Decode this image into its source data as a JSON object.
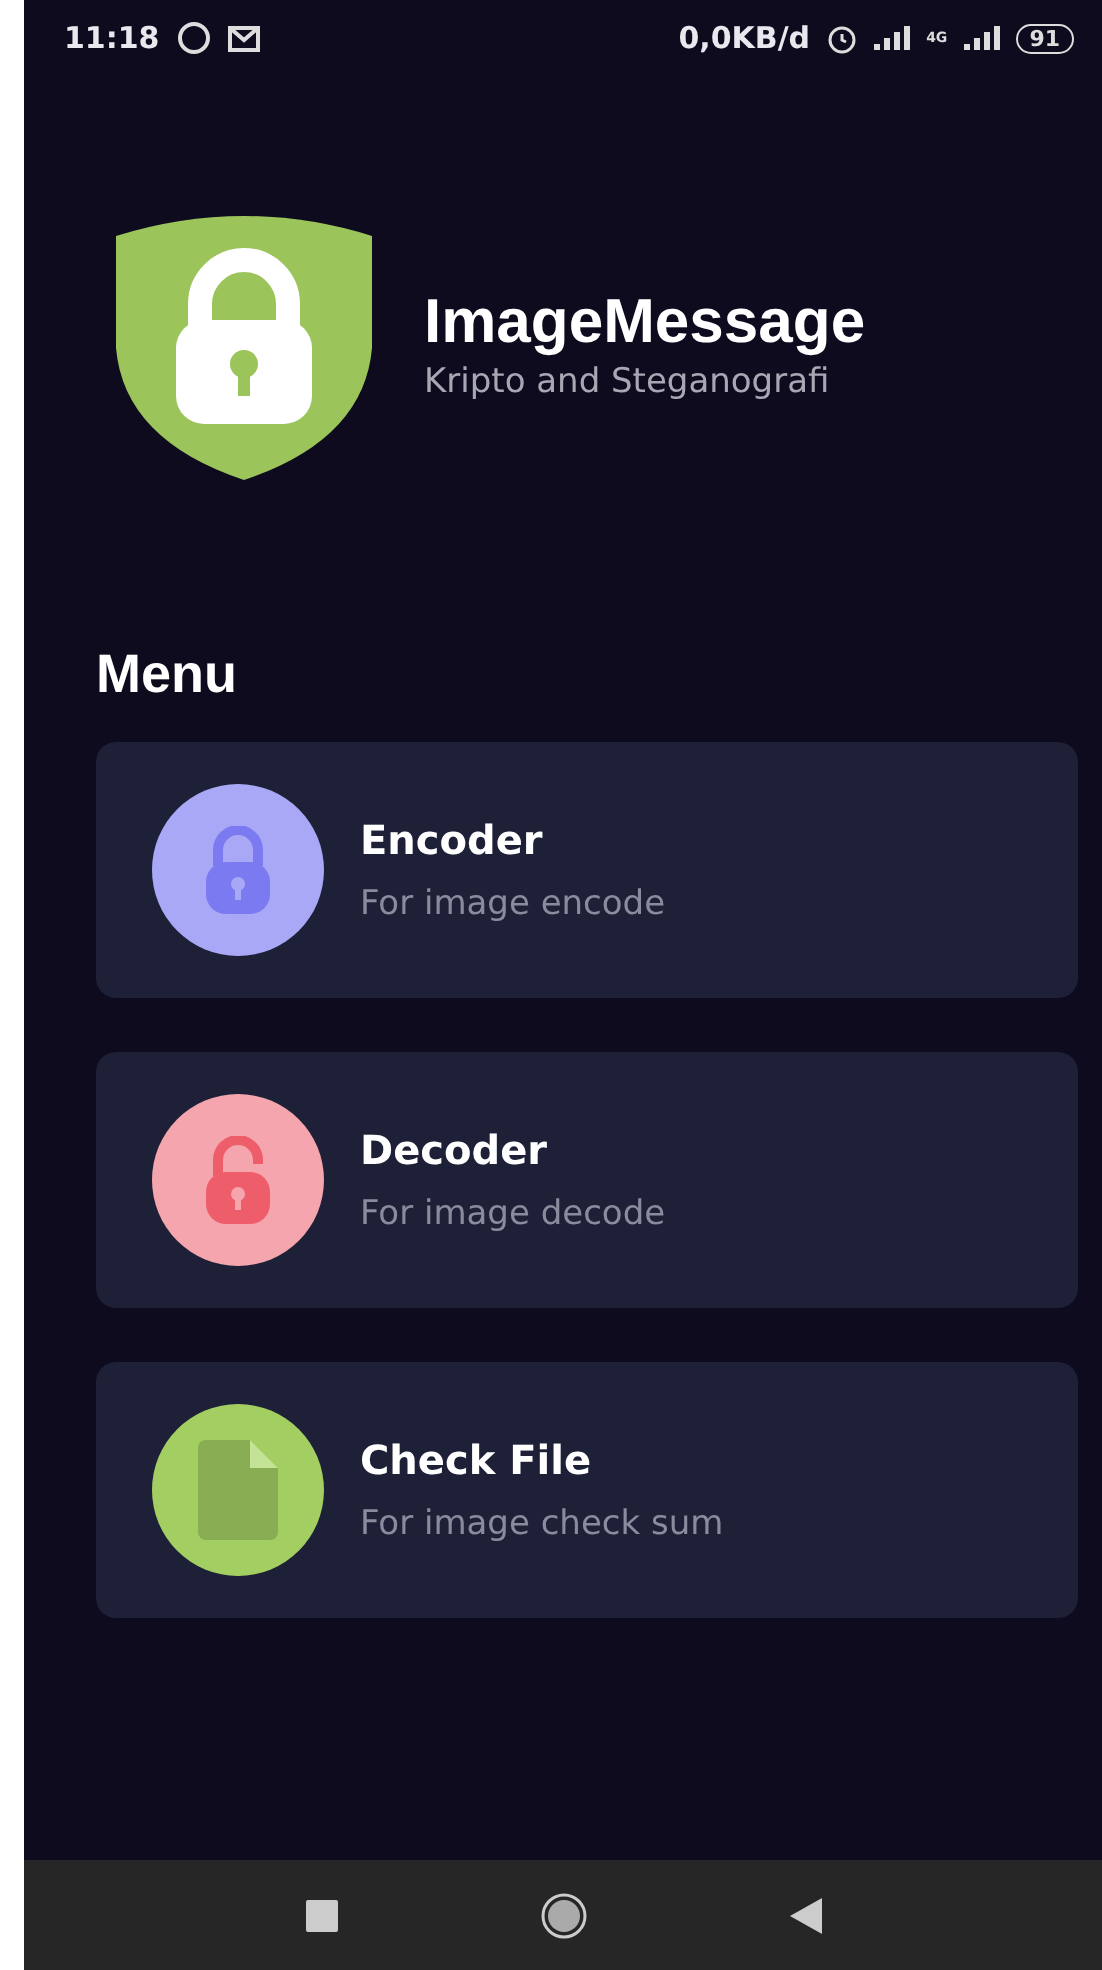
{
  "status_bar": {
    "time": "11:18",
    "data_rate": "0,0KB/d",
    "network": "4G",
    "battery": "91"
  },
  "header": {
    "title": "ImageMessage",
    "subtitle": "Kripto and Steganografi"
  },
  "menu_heading": "Menu",
  "menu_items": [
    {
      "kind": "lock",
      "title": "Encoder",
      "subtitle": "For image encode",
      "color": "#a9a8f6"
    },
    {
      "kind": "unlock",
      "title": "Decoder",
      "subtitle": "For image decode",
      "color": "#f4a5ad"
    },
    {
      "kind": "file",
      "title": "Check File",
      "subtitle": "For image check sum",
      "color": "#a3cf62"
    }
  ]
}
